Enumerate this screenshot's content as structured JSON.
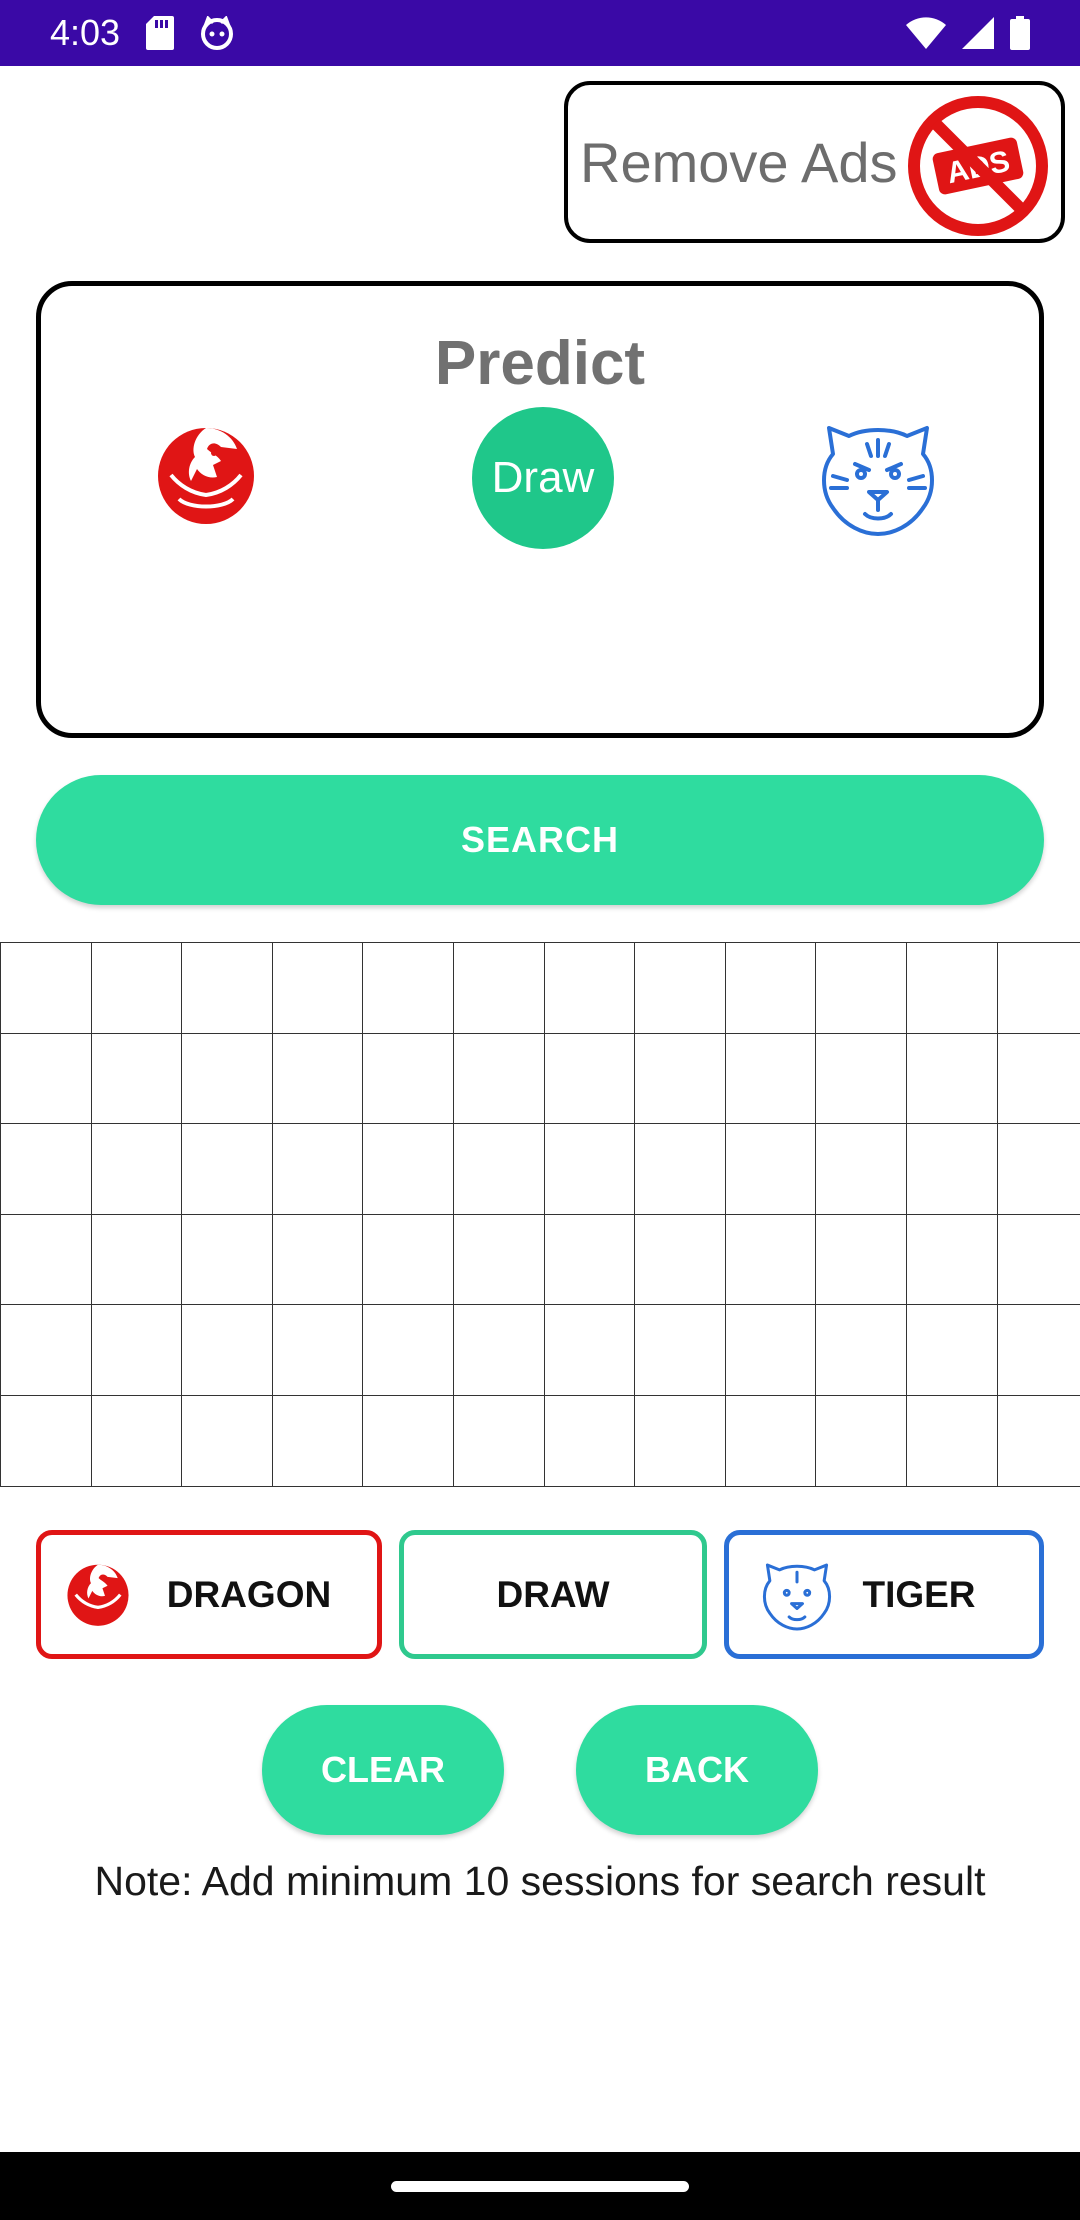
{
  "status_bar": {
    "time": "4:03",
    "icons": [
      "sd-card-icon",
      "face-notification-icon",
      "wifi-icon",
      "signal-icon",
      "battery-icon"
    ],
    "background": "#3a09a6"
  },
  "remove_ads": {
    "label": "Remove Ads",
    "badge_text": "ADS",
    "color": "#e01515"
  },
  "predict": {
    "title": "Predict",
    "draw_label": "Draw",
    "draw_color": "#1fc78a"
  },
  "search": {
    "label": "SEARCH",
    "color": "#2fdc9f"
  },
  "grid": {
    "rows": 6,
    "columns": 12
  },
  "choices": {
    "dragon": {
      "label": "DRAGON",
      "color": "#e01515"
    },
    "draw": {
      "label": "DRAW",
      "color": "#2fc98e"
    },
    "tiger": {
      "label": "TIGER",
      "color": "#2a6fd6"
    }
  },
  "actions": {
    "clear_label": "CLEAR",
    "back_label": "BACK"
  },
  "note": "Note: Add minimum 10 sessions for search result"
}
